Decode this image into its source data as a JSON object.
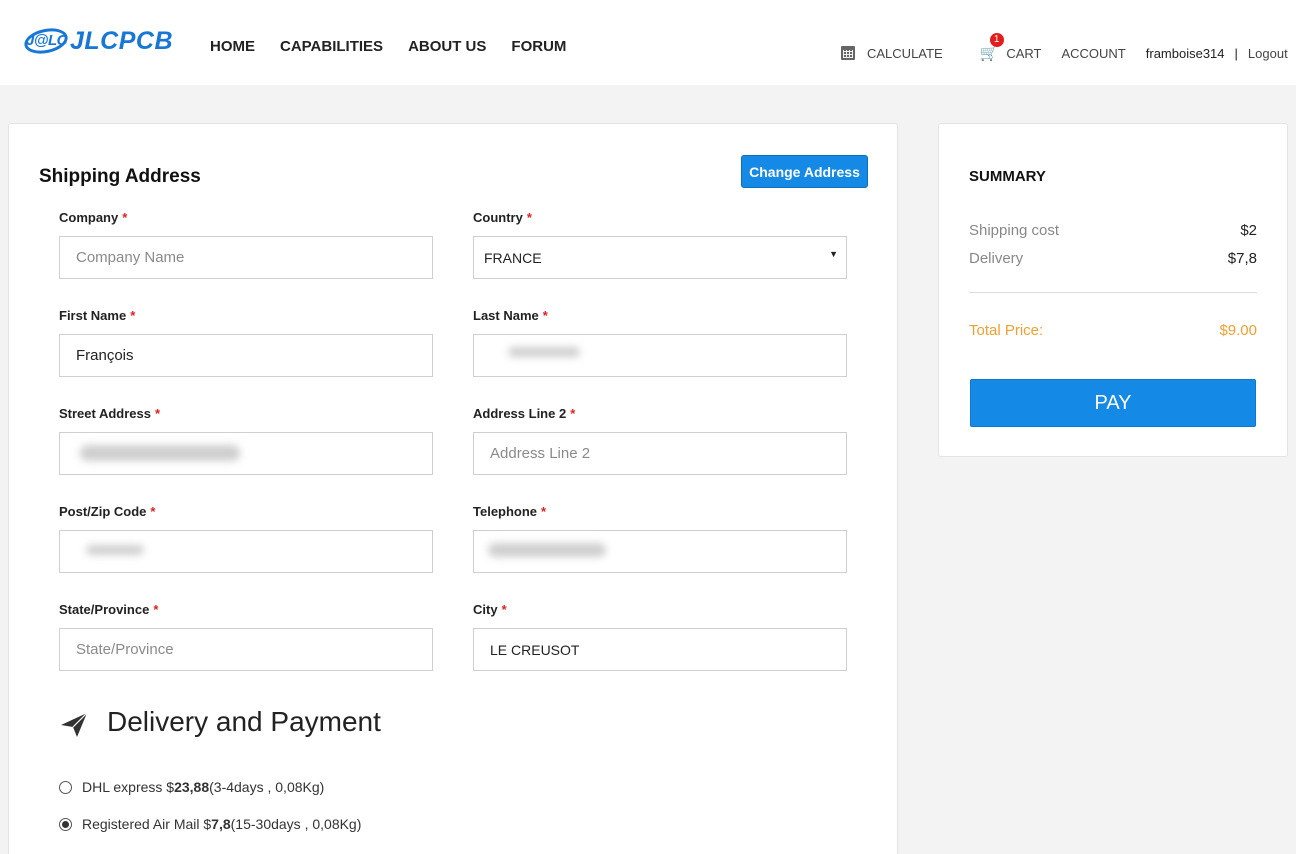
{
  "brand": {
    "badge": "J@LC",
    "name": "JLCPCB"
  },
  "nav": [
    {
      "label": "HOME"
    },
    {
      "label": "CAPABILITIES"
    },
    {
      "label": "ABOUT US"
    },
    {
      "label": "FORUM"
    }
  ],
  "topbar": {
    "calculate": "CALCULATE",
    "cart": "CART",
    "cart_count": "1",
    "account": "ACCOUNT",
    "username": "framboise314",
    "separator": "|",
    "logout": "Logout"
  },
  "shipping": {
    "title": "Shipping Address",
    "change_button": "Change Address",
    "required_mark": "*",
    "fields": {
      "company": {
        "label": "Company",
        "placeholder": "Company Name",
        "value": ""
      },
      "country": {
        "label": "Country",
        "value": "FRANCE"
      },
      "first_name": {
        "label": "First Name",
        "value": "François"
      },
      "last_name": {
        "label": "Last Name",
        "value": ""
      },
      "street": {
        "label": "Street Address",
        "value": ""
      },
      "address2": {
        "label": "Address Line 2",
        "placeholder": "Address Line 2",
        "value": ""
      },
      "zip": {
        "label": "Post/Zip Code",
        "value": ""
      },
      "telephone": {
        "label": "Telephone",
        "value": ""
      },
      "state": {
        "label": "State/Province",
        "placeholder": "State/Province",
        "value": ""
      },
      "city": {
        "label": "City",
        "value": "LE CREUSOT"
      }
    }
  },
  "delivery": {
    "title": "Delivery and Payment",
    "options": [
      {
        "name": "DHL express $",
        "price": "23,88",
        "detail": "(3-4days , 0,08Kg)",
        "selected": false
      },
      {
        "name": "Registered Air Mail $",
        "price": "7,8",
        "detail": "(15-30days , 0,08Kg)",
        "selected": true
      }
    ]
  },
  "summary": {
    "title": "SUMMARY",
    "shipping_cost_label": "Shipping cost",
    "shipping_cost_value": "$2",
    "delivery_label": "Delivery",
    "delivery_value": "$7,8",
    "total_label": "Total Price:",
    "total_value": "$9.00",
    "pay_label": "PAY",
    "accent_color": "#f0a030",
    "button_color": "#1589e6"
  }
}
